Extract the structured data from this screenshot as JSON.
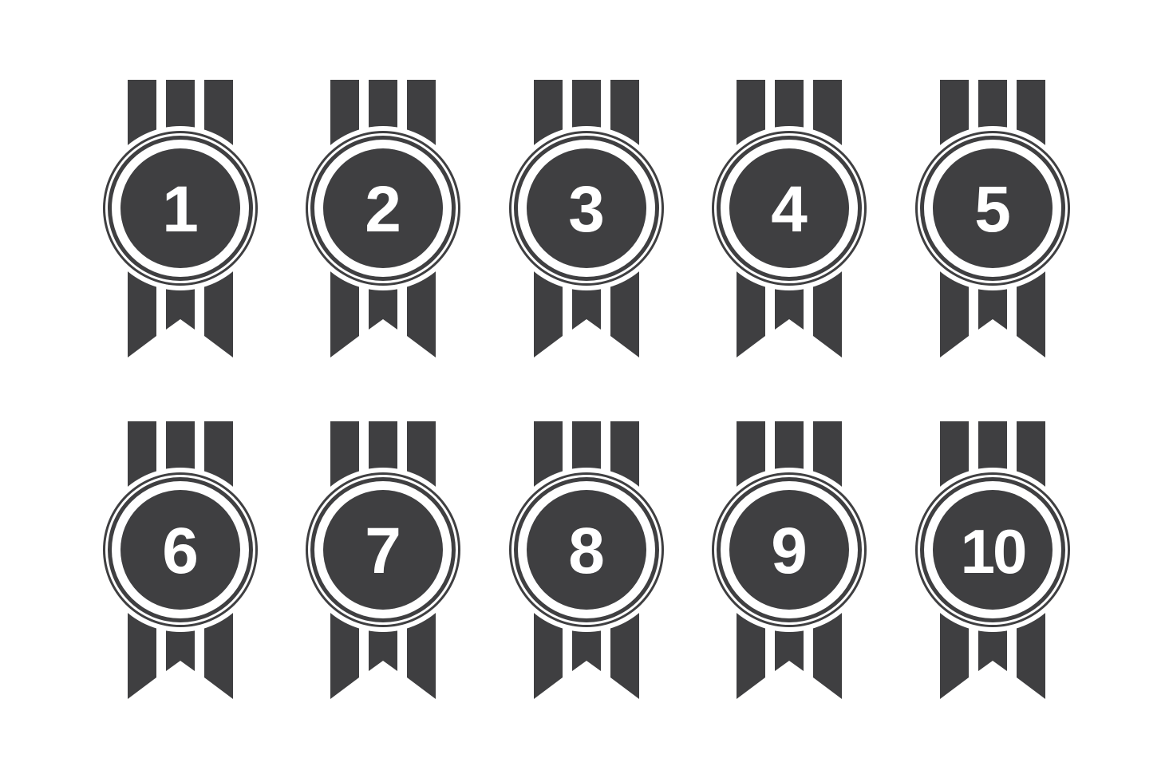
{
  "palette": {
    "medal": "#3f3f41",
    "background": "#ffffff",
    "number": "#ffffff"
  },
  "medals": [
    {
      "label": "1",
      "icon": "ribbon-medal-icon"
    },
    {
      "label": "2",
      "icon": "ribbon-medal-icon"
    },
    {
      "label": "3",
      "icon": "ribbon-medal-icon"
    },
    {
      "label": "4",
      "icon": "ribbon-medal-icon"
    },
    {
      "label": "5",
      "icon": "ribbon-medal-icon"
    },
    {
      "label": "6",
      "icon": "ribbon-medal-icon"
    },
    {
      "label": "7",
      "icon": "ribbon-medal-icon"
    },
    {
      "label": "8",
      "icon": "ribbon-medal-icon"
    },
    {
      "label": "9",
      "icon": "ribbon-medal-icon"
    },
    {
      "label": "10",
      "icon": "ribbon-medal-icon"
    }
  ]
}
